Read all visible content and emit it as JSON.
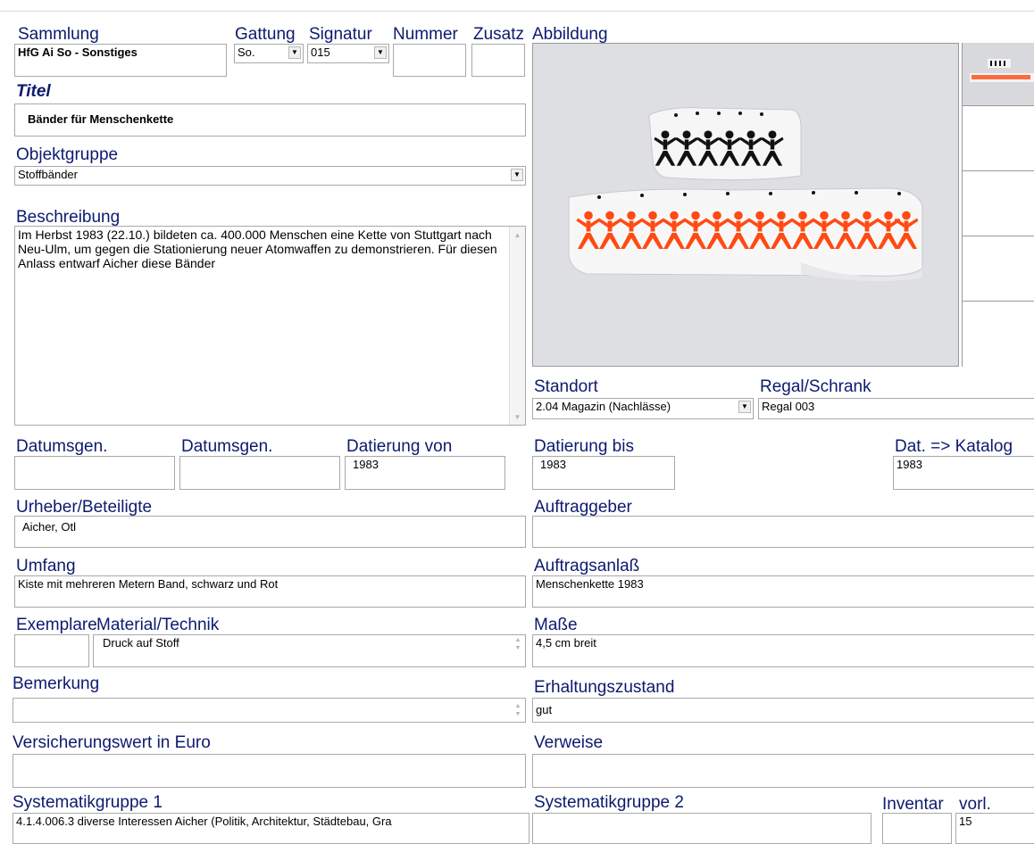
{
  "labels": {
    "sammlung": "Sammlung",
    "gattung": "Gattung",
    "signatur": "Signatur",
    "nummer": "Nummer",
    "zusatz": "Zusatz",
    "abbildung": "Abbildung",
    "titel": "Titel",
    "objektgruppe": "Objektgruppe",
    "beschreibung": "Beschreibung",
    "standort": "Standort",
    "regal": "Regal/Schrank",
    "datumsgen1": "Datumsgen.",
    "datumsgen2": "Datumsgen.",
    "datierung_von": "Datierung von",
    "datierung_bis": "Datierung bis",
    "dat_katalog": "Dat. => Katalog",
    "urheber": "Urheber/Beteiligte",
    "auftraggeber": "Auftraggeber",
    "umfang": "Umfang",
    "auftragsanlass": "Auftragsanlaß",
    "exemplare": "Exemplare",
    "material": "Material/Technik",
    "masse": "Maße",
    "bemerkung": "Bemerkung",
    "erhaltungszustand": "Erhaltungszustand",
    "versicherungswert": "Versicherungswert in Euro",
    "verweise": "Verweise",
    "systematik1": "Systematikgruppe 1",
    "systematik2": "Systematikgruppe 2",
    "inventar": "Inventar",
    "vorl": "vorl."
  },
  "values": {
    "sammlung": "HfG Ai So - Sonstiges",
    "gattung": "So.",
    "signatur": "015",
    "nummer": "",
    "zusatz": "",
    "titel": "Bänder für Menschenkette",
    "objektgruppe": "Stoffbänder",
    "beschreibung": "Im Herbst 1983 (22.10.) bildeten ca. 400.000 Menschen eine Kette von Stuttgart nach Neu-Ulm, um gegen die Stationierung neuer Atomwaffen zu demonstrieren. Für diesen Anlass entwarf Aicher diese Bänder",
    "standort": "2.04 Magazin (Nachlässe)",
    "regal": "Regal 003",
    "datumsgen1": "",
    "datumsgen2": "",
    "datierung_von": "1983",
    "datierung_bis": "1983",
    "dat_katalog": "1983",
    "urheber": "Aicher, Otl",
    "auftraggeber": "",
    "umfang": "Kiste mit mehreren Metern Band, schwarz und Rot",
    "auftragsanlass": "Menschenkette 1983",
    "exemplare": "",
    "material": "Druck auf Stoff",
    "masse": "4,5 cm breit",
    "bemerkung": "",
    "erhaltungszustand": "gut",
    "versicherungswert": "",
    "verweise": "",
    "systematik1": "4.1.4.006.3 diverse Interessen Aicher (Politik, Architektur, Städtebau, Gra",
    "systematik2": "",
    "inventar": "",
    "vorl": "15"
  },
  "icons": {
    "dropdown": "chevron-down-icon",
    "scroll_up": "scroll-up-arrow-icon",
    "scroll_down": "scroll-down-arrow-icon",
    "spin": "spinner-arrows-icon"
  },
  "colors": {
    "label_text": "#0c1a6e",
    "border": "#a9a9a9",
    "photo_bg": "#e2e3e5",
    "band_black": "#111111",
    "band_orange": "#ff4a12"
  }
}
